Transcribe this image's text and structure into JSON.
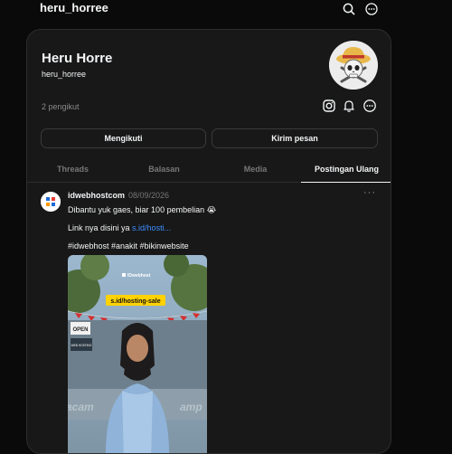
{
  "header": {
    "title": "heru_horree",
    "icons": [
      "search-icon",
      "more-icon"
    ]
  },
  "profile": {
    "display_name": "Heru Horre",
    "username": "heru_horree",
    "followers": "2 pengikut",
    "avatar": "skull-straw-hat-avatar",
    "action_icons": [
      "instagram-icon",
      "bell-icon",
      "more-icon"
    ]
  },
  "buttons": {
    "follow": "Mengikuti",
    "message": "Kirim pesan"
  },
  "tabs": [
    {
      "label": "Threads",
      "active": false
    },
    {
      "label": "Balasan",
      "active": false
    },
    {
      "label": "Media",
      "active": false
    },
    {
      "label": "Postingan Ulang",
      "active": true
    }
  ],
  "post": {
    "author": "idwebhostcom",
    "date": "08/09/2026",
    "text_line1": "Dibantu yuk gaes, biar 100 pembelian 😭",
    "link_prefix": "Link nya disini ya ",
    "link_text": "s.id/hosti...",
    "hashtags": "#idwebhost #anakit #bikinwebsite",
    "more": "···",
    "image": {
      "brand": "IDwebhost",
      "sticker": "s.id/hosting-sale",
      "sign_open": "OPEN",
      "sign_web": "WEB HOSTING",
      "bg_text_left": "acam",
      "bg_text_right": "amp"
    }
  },
  "colors": {
    "background": "#0a0a0a",
    "card": "#181818",
    "link": "#3a8eff",
    "sticker": "#ffd200"
  }
}
